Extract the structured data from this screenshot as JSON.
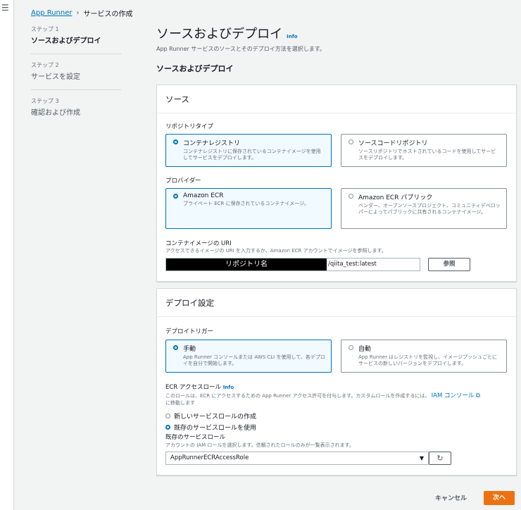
{
  "breadcrumb": {
    "root": "App Runner",
    "current": "サービスの作成"
  },
  "steps": [
    {
      "num": "ステップ 1",
      "name": "ソースおよびデプロイ",
      "active": true
    },
    {
      "num": "ステップ 2",
      "name": "サービスを設定",
      "active": false
    },
    {
      "num": "ステップ 3",
      "name": "確認および作成",
      "active": false
    }
  ],
  "page": {
    "title": "ソースおよびデプロイ",
    "info": "Info",
    "subtitle": "App Runner サービスのソースとそのデプロイ方法を選択します。",
    "section_title": "ソースおよびデプロイ"
  },
  "source_panel": {
    "header": "ソース",
    "repo_type_label": "リポジトリタイプ",
    "repo_tiles": [
      {
        "title": "コンテナレジストリ",
        "desc": "コンテナレジストリに保存されているコンテナイメージを使用してサービスをデプロイします。",
        "selected": true
      },
      {
        "title": "ソースコードリポジトリ",
        "desc": "ソースリポジトリでホストされているコードを使用してサービスをデプロイします。",
        "selected": false
      }
    ],
    "provider_label": "プロバイダー",
    "provider_tiles": [
      {
        "title": "Amazon ECR",
        "desc": "プライベート ECR に保存されているコンテナイメージ。",
        "selected": true
      },
      {
        "title": "Amazon ECR パブリック",
        "desc": "ベンダー、オープンソースプロジェクト、コミュニティデベロッパーによってパブリックに共有されるコンテナイメージ。",
        "selected": false
      }
    ],
    "uri_label": "コンテナイメージの URI",
    "uri_help": "アクセスできるイメージの URI を入力するか、Amazon ECR アカウントでイメージを参照します。",
    "uri_redacted": "リポジトリ名",
    "uri_tail": "/qiita_test:latest",
    "browse_button": "参照"
  },
  "deploy_panel": {
    "header": "デプロイ設定",
    "trigger_label": "デプロイトリガー",
    "trigger_tiles": [
      {
        "title": "手動",
        "desc": "App Runner コンソールまたは AWS CLI を使用して、各デプロイを自分で開始します。",
        "selected": true
      },
      {
        "title": "自動",
        "desc": "App Runner はレジストリを監視し、イメージプッシュごとにサービスの新しいバージョンをデプロイします。",
        "selected": false
      }
    ],
    "role_label": "ECR アクセスロール",
    "role_info": "Info",
    "role_help": "このロールは、ECR にアクセスするための App Runner アクセス許可を付与します。カスタムロールを作成するには、",
    "role_help_link": "IAM コンソール",
    "role_help_tail": "に移動します",
    "role_options": [
      {
        "label": "新しいサービスロールの作成",
        "selected": false
      },
      {
        "label": "既存のサービスロールを使用",
        "selected": true
      }
    ],
    "existing_role_label": "既存のサービスロール",
    "existing_role_help": "アカウントの IAM ロールを選択します。信頼されたロールのみが一覧表示されます。",
    "existing_role_value": "AppRunnerECRAccessRole"
  },
  "footer": {
    "cancel": "キャンセル",
    "next": "次へ"
  },
  "colors": {
    "accent": "#0073bb",
    "primary_button": "#ec7211"
  }
}
